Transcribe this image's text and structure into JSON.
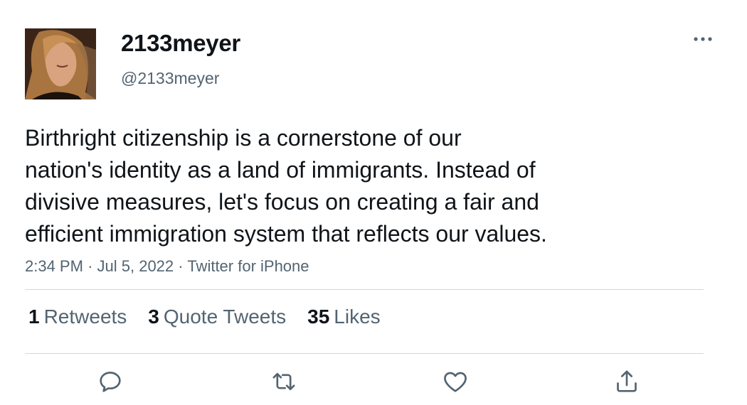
{
  "user": {
    "display_name": "2133meyer",
    "handle": "@2133meyer"
  },
  "tweet": {
    "lines": [
      "Birthright citizenship is a cornerstone of our",
      "nation's identity as a land of immigrants. Instead of",
      "divisive measures, let's focus on creating a fair and",
      "efficient immigration system that reflects our values."
    ],
    "time": "2:34 PM",
    "date": "Jul 5, 2022",
    "source": "Twitter for iPhone",
    "separator": "·"
  },
  "stats": {
    "retweets": {
      "count": "1",
      "label": "Retweets"
    },
    "quotes": {
      "count": "3",
      "label": "Quote Tweets"
    },
    "likes": {
      "count": "35",
      "label": "Likes"
    }
  },
  "icons": {
    "more": "more-horizontal-icon",
    "reply": "reply-icon",
    "retweet": "retweet-icon",
    "like": "heart-icon",
    "share": "share-icon"
  },
  "colors": {
    "text": "#0f1419",
    "secondary": "#536471",
    "divider": "#cfd9de"
  }
}
